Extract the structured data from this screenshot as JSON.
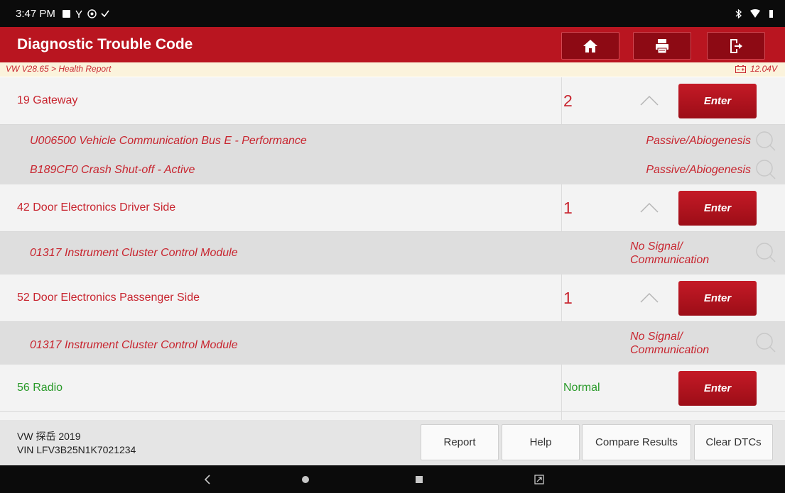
{
  "status_bar": {
    "time": "3:47 PM"
  },
  "header": {
    "title": "Diagnostic Trouble Code"
  },
  "breadcrumb": {
    "path": "VW V28.65 > Health Report",
    "voltage": "12.04V"
  },
  "systems": [
    {
      "name": "19 Gateway",
      "count": "2",
      "enter": "Enter"
    },
    {
      "name": "42 Door Electronics Driver Side",
      "count": "1",
      "enter": "Enter"
    },
    {
      "name": "52 Door Electronics Passenger Side",
      "count": "1",
      "enter": "Enter"
    },
    {
      "name": "56 Radio",
      "status": "Normal",
      "enter": "Enter"
    }
  ],
  "dtcs": [
    {
      "code": "U006500 Vehicle Communication Bus E - Performance",
      "status": "Passive/Abiogenesis"
    },
    {
      "code": "B189CF0 Crash Shut-off - Active",
      "status": "Passive/Abiogenesis"
    },
    {
      "code": "01317 Instrument Cluster Control Module",
      "status_line1": "No Signal/",
      "status_line2": "Communication"
    },
    {
      "code": "01317 Instrument Cluster Control Module",
      "status_line1": "No Signal/",
      "status_line2": "Communication"
    }
  ],
  "footer": {
    "vehicle": "VW 探岳 2019",
    "vin": "VIN LFV3B25N1K7021234",
    "buttons": {
      "report": "Report",
      "help": "Help",
      "compare": "Compare Results",
      "clear": "Clear DTCs"
    }
  },
  "colors": {
    "header_red": "#b91520",
    "fault_red": "#c8252f",
    "normal_green": "#2a9a2a",
    "breadcrumb_bg": "#fbf3dc"
  },
  "icons": [
    "home-icon",
    "print-icon",
    "exit-icon",
    "battery-icon",
    "chevron-up-icon",
    "magnifier-icon",
    "back-icon",
    "home-dot-icon",
    "recents-icon",
    "screenshot-icon"
  ]
}
